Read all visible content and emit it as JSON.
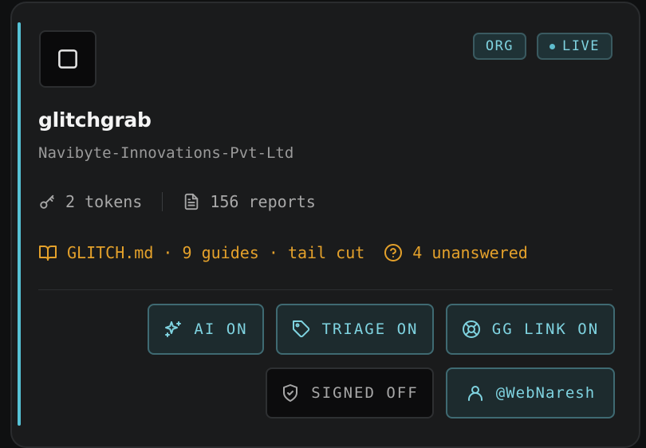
{
  "project": {
    "name": "glitchgrab",
    "org": "Navibyte-Innovations-Pvt-Ltd"
  },
  "badges": [
    {
      "label": "ORG",
      "icon": "none"
    },
    {
      "label": "LIVE",
      "icon": "status-dot"
    }
  ],
  "stats": {
    "tokens": "2 tokens",
    "reports": "156 reports"
  },
  "meta": {
    "guide_file": "GLITCH.md · 9 guides · tail cut",
    "unanswered": "4 unanswered"
  },
  "buttons": {
    "ai": {
      "label": "AI ON",
      "icon": "sparkles-icon"
    },
    "triage": {
      "label": "TRIAGE ON",
      "icon": "tag-icon"
    },
    "gg_link": {
      "label": "GG LINK ON",
      "icon": "lifebuoy-icon"
    },
    "signed": {
      "label": "SIGNED OFF",
      "icon": "shield-check-icon"
    },
    "user": {
      "label": "@WebNaresh",
      "icon": "user-icon"
    }
  },
  "colors": {
    "accent": "#56c2d6",
    "warning": "#e4a12b",
    "background": "#1a1b1c"
  }
}
